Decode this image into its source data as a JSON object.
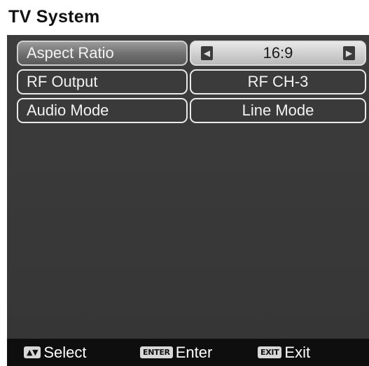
{
  "window": {
    "title": "TV System"
  },
  "menu": {
    "rows": [
      {
        "label": "Aspect Ratio",
        "value": "16:9",
        "selected": true
      },
      {
        "label": "RF Output",
        "value": "RF CH-3",
        "selected": false
      },
      {
        "label": "Audio Mode",
        "value": "Line Mode",
        "selected": false
      }
    ]
  },
  "footer": {
    "select": {
      "key": "▲▼",
      "label": "Select"
    },
    "enter": {
      "key": "ENTER",
      "label": "Enter"
    },
    "exit": {
      "key": "EXIT",
      "label": "Exit"
    }
  },
  "colors": {
    "background": "#3a3a3a",
    "footer": "#0e0e0e",
    "selected_value": "#cfcfcf"
  }
}
